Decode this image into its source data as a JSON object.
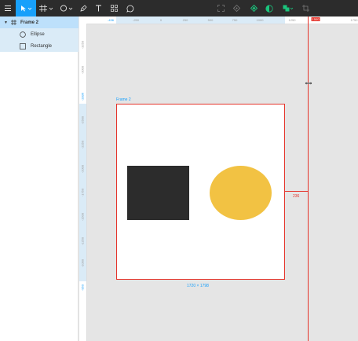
{
  "toolbar": {
    "tools": [
      "menu",
      "move",
      "frame",
      "shape",
      "pen",
      "text",
      "components",
      "comment"
    ],
    "active_tool": "move",
    "accent_color": "#18a0fb"
  },
  "layers": {
    "frame_label": "Frame 2",
    "children": [
      {
        "label": "Ellipse",
        "icon": "ellipse-icon"
      },
      {
        "label": "Rectangle",
        "icon": "rectangle-icon"
      }
    ]
  },
  "rulers": {
    "top": [
      "-436",
      "-250",
      "0",
      "250",
      "500",
      "750",
      "1000",
      "1250",
      "1500",
      "1750"
    ],
    "left": [
      "-3250",
      "-3000",
      "-2836",
      "-2500",
      "-2250",
      "-2000",
      "-1750",
      "-1500",
      "-1250",
      "-1000",
      "-950"
    ],
    "highlight_color": "#daebf7",
    "guide_color": "#e5332a"
  },
  "canvas": {
    "frame_label": "Frame 2",
    "size_label": "1720 × 1798",
    "guide_measure": "236",
    "rectangle_color": "#2c2c2c",
    "ellipse_color": "#f2c243"
  }
}
